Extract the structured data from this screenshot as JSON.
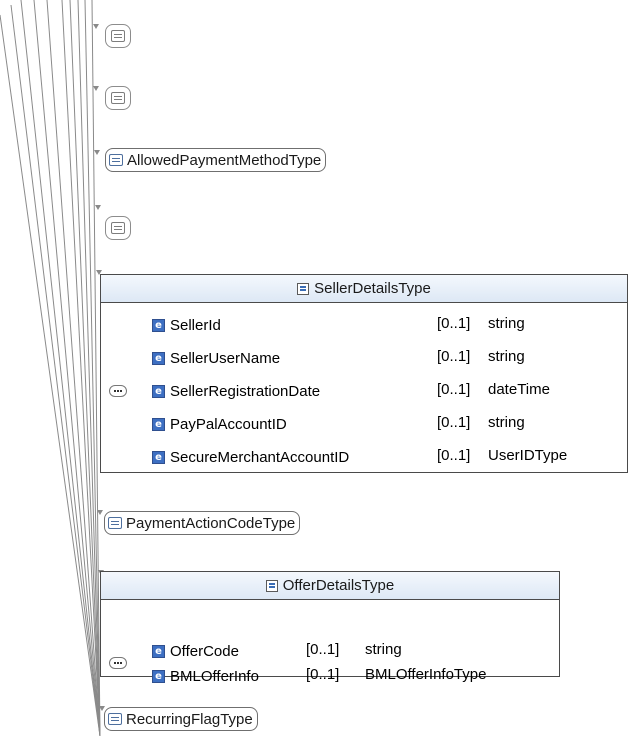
{
  "simple_types": {
    "empty_1": "",
    "empty_2": "",
    "allowed_payment": "AllowedPaymentMethodType",
    "empty_3": "",
    "payment_action": "PaymentActionCodeType",
    "recurring_flag": "RecurringFlagType"
  },
  "seller_details": {
    "title": "SellerDetailsType",
    "rows": [
      {
        "name": "SellerId",
        "occurs": "[0..1]",
        "type": "string"
      },
      {
        "name": "SellerUserName",
        "occurs": "[0..1]",
        "type": "string"
      },
      {
        "name": "SellerRegistrationDate",
        "occurs": "[0..1]",
        "type": "dateTime"
      },
      {
        "name": "PayPalAccountID",
        "occurs": "[0..1]",
        "type": "string"
      },
      {
        "name": "SecureMerchantAccountID",
        "occurs": "[0..1]",
        "type": "UserIDType"
      }
    ]
  },
  "offer_details": {
    "title": "OfferDetailsType",
    "rows": [
      {
        "name": "OfferCode",
        "occurs": "[0..1]",
        "type": "string"
      },
      {
        "name": "BMLOfferInfo",
        "occurs": "[0..1]",
        "type": "BMLOfferInfoType"
      }
    ]
  }
}
